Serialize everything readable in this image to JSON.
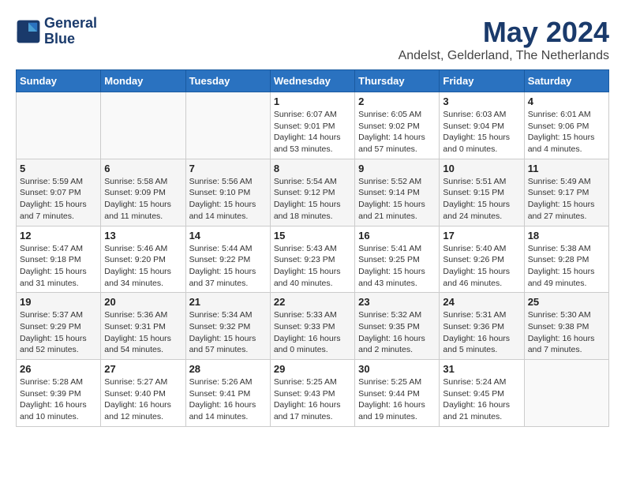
{
  "logo": {
    "line1": "General",
    "line2": "Blue"
  },
  "title": "May 2024",
  "subtitle": "Andelst, Gelderland, The Netherlands",
  "header_days": [
    "Sunday",
    "Monday",
    "Tuesday",
    "Wednesday",
    "Thursday",
    "Friday",
    "Saturday"
  ],
  "weeks": [
    [
      {
        "day": "",
        "info": ""
      },
      {
        "day": "",
        "info": ""
      },
      {
        "day": "",
        "info": ""
      },
      {
        "day": "1",
        "info": "Sunrise: 6:07 AM\nSunset: 9:01 PM\nDaylight: 14 hours and 53 minutes."
      },
      {
        "day": "2",
        "info": "Sunrise: 6:05 AM\nSunset: 9:02 PM\nDaylight: 14 hours and 57 minutes."
      },
      {
        "day": "3",
        "info": "Sunrise: 6:03 AM\nSunset: 9:04 PM\nDaylight: 15 hours and 0 minutes."
      },
      {
        "day": "4",
        "info": "Sunrise: 6:01 AM\nSunset: 9:06 PM\nDaylight: 15 hours and 4 minutes."
      }
    ],
    [
      {
        "day": "5",
        "info": "Sunrise: 5:59 AM\nSunset: 9:07 PM\nDaylight: 15 hours and 7 minutes."
      },
      {
        "day": "6",
        "info": "Sunrise: 5:58 AM\nSunset: 9:09 PM\nDaylight: 15 hours and 11 minutes."
      },
      {
        "day": "7",
        "info": "Sunrise: 5:56 AM\nSunset: 9:10 PM\nDaylight: 15 hours and 14 minutes."
      },
      {
        "day": "8",
        "info": "Sunrise: 5:54 AM\nSunset: 9:12 PM\nDaylight: 15 hours and 18 minutes."
      },
      {
        "day": "9",
        "info": "Sunrise: 5:52 AM\nSunset: 9:14 PM\nDaylight: 15 hours and 21 minutes."
      },
      {
        "day": "10",
        "info": "Sunrise: 5:51 AM\nSunset: 9:15 PM\nDaylight: 15 hours and 24 minutes."
      },
      {
        "day": "11",
        "info": "Sunrise: 5:49 AM\nSunset: 9:17 PM\nDaylight: 15 hours and 27 minutes."
      }
    ],
    [
      {
        "day": "12",
        "info": "Sunrise: 5:47 AM\nSunset: 9:18 PM\nDaylight: 15 hours and 31 minutes."
      },
      {
        "day": "13",
        "info": "Sunrise: 5:46 AM\nSunset: 9:20 PM\nDaylight: 15 hours and 34 minutes."
      },
      {
        "day": "14",
        "info": "Sunrise: 5:44 AM\nSunset: 9:22 PM\nDaylight: 15 hours and 37 minutes."
      },
      {
        "day": "15",
        "info": "Sunrise: 5:43 AM\nSunset: 9:23 PM\nDaylight: 15 hours and 40 minutes."
      },
      {
        "day": "16",
        "info": "Sunrise: 5:41 AM\nSunset: 9:25 PM\nDaylight: 15 hours and 43 minutes."
      },
      {
        "day": "17",
        "info": "Sunrise: 5:40 AM\nSunset: 9:26 PM\nDaylight: 15 hours and 46 minutes."
      },
      {
        "day": "18",
        "info": "Sunrise: 5:38 AM\nSunset: 9:28 PM\nDaylight: 15 hours and 49 minutes."
      }
    ],
    [
      {
        "day": "19",
        "info": "Sunrise: 5:37 AM\nSunset: 9:29 PM\nDaylight: 15 hours and 52 minutes."
      },
      {
        "day": "20",
        "info": "Sunrise: 5:36 AM\nSunset: 9:31 PM\nDaylight: 15 hours and 54 minutes."
      },
      {
        "day": "21",
        "info": "Sunrise: 5:34 AM\nSunset: 9:32 PM\nDaylight: 15 hours and 57 minutes."
      },
      {
        "day": "22",
        "info": "Sunrise: 5:33 AM\nSunset: 9:33 PM\nDaylight: 16 hours and 0 minutes."
      },
      {
        "day": "23",
        "info": "Sunrise: 5:32 AM\nSunset: 9:35 PM\nDaylight: 16 hours and 2 minutes."
      },
      {
        "day": "24",
        "info": "Sunrise: 5:31 AM\nSunset: 9:36 PM\nDaylight: 16 hours and 5 minutes."
      },
      {
        "day": "25",
        "info": "Sunrise: 5:30 AM\nSunset: 9:38 PM\nDaylight: 16 hours and 7 minutes."
      }
    ],
    [
      {
        "day": "26",
        "info": "Sunrise: 5:28 AM\nSunset: 9:39 PM\nDaylight: 16 hours and 10 minutes."
      },
      {
        "day": "27",
        "info": "Sunrise: 5:27 AM\nSunset: 9:40 PM\nDaylight: 16 hours and 12 minutes."
      },
      {
        "day": "28",
        "info": "Sunrise: 5:26 AM\nSunset: 9:41 PM\nDaylight: 16 hours and 14 minutes."
      },
      {
        "day": "29",
        "info": "Sunrise: 5:25 AM\nSunset: 9:43 PM\nDaylight: 16 hours and 17 minutes."
      },
      {
        "day": "30",
        "info": "Sunrise: 5:25 AM\nSunset: 9:44 PM\nDaylight: 16 hours and 19 minutes."
      },
      {
        "day": "31",
        "info": "Sunrise: 5:24 AM\nSunset: 9:45 PM\nDaylight: 16 hours and 21 minutes."
      },
      {
        "day": "",
        "info": ""
      }
    ]
  ]
}
